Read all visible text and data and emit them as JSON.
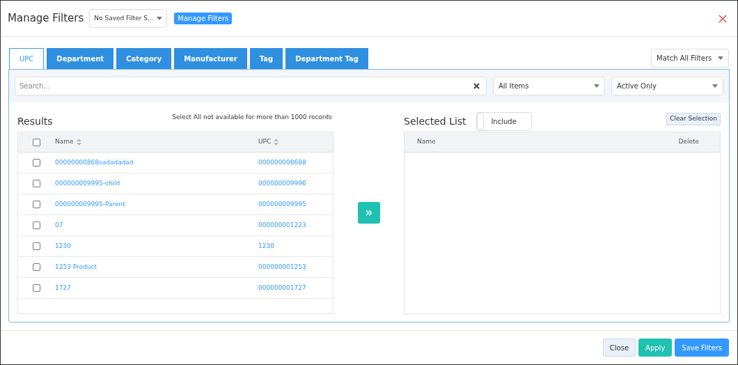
{
  "window": {
    "title": "Manage Filters",
    "saved_filter": "No Saved Filter S...",
    "manage_button": "Manage Filters"
  },
  "tabs": [
    {
      "label": "UPC",
      "selected": true
    },
    {
      "label": "Department",
      "selected": false
    },
    {
      "label": "Category",
      "selected": false
    },
    {
      "label": "Manufacturer",
      "selected": false
    },
    {
      "label": "Tag",
      "selected": false
    },
    {
      "label": "Department Tag",
      "selected": false
    }
  ],
  "match_select": "Match All Filters",
  "search": {
    "placeholder": "Search..."
  },
  "filters": [
    "All Items",
    "Active Only"
  ],
  "results": {
    "title": "Results",
    "note": "Select All not available for more than 1000 records",
    "select_all_checked": false,
    "columns": [
      "Name",
      "UPC"
    ],
    "rows": [
      {
        "name": "00000000868sadadadad",
        "upc": "000000008688",
        "checked": false
      },
      {
        "name": "000000009995-child",
        "upc": "000000009996",
        "checked": false
      },
      {
        "name": "000000009995-Parent",
        "upc": "000000009995",
        "checked": false
      },
      {
        "name": "07",
        "upc": "000000001223",
        "checked": false
      },
      {
        "name": "1230",
        "upc": "1230",
        "checked": false
      },
      {
        "name": "1253 Product",
        "upc": "000000001253",
        "checked": false
      },
      {
        "name": "1727",
        "upc": "000000001727",
        "checked": false
      }
    ]
  },
  "selected_list": {
    "title": "Selected List",
    "toggle": {
      "label": "Include",
      "on": false
    },
    "clear_button": "Clear Selection",
    "columns": [
      "Name",
      "Delete"
    ]
  },
  "footer": {
    "buttons": [
      {
        "label": "Close",
        "kind": "default"
      },
      {
        "label": "Apply",
        "kind": "success"
      },
      {
        "label": "Save Filters",
        "kind": "primary"
      }
    ]
  }
}
